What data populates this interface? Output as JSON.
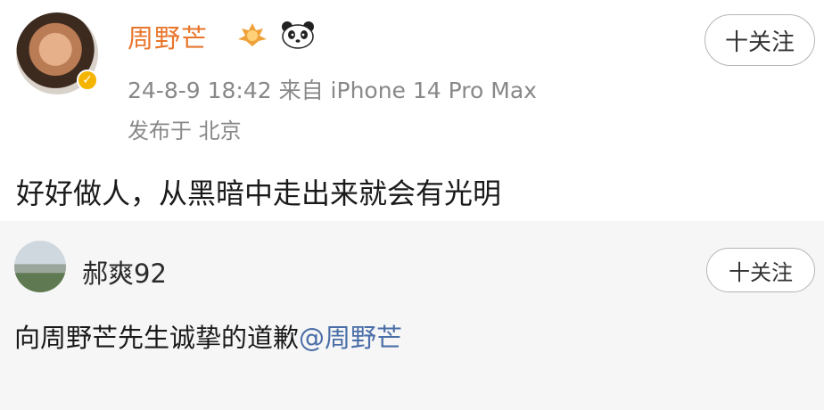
{
  "post": {
    "author": "周野芒",
    "meta": "24-8-9 18:42  来自 iPhone 14 Pro Max",
    "location": "发布于 北京",
    "follow_label": "十关注",
    "content": "好好做人，从黑暗中走出来就会有光明"
  },
  "comment": {
    "author": "郝爽92",
    "follow_label": "十关注",
    "text": "向周野芒先生诚挚的道歉",
    "mention": "@周野芒"
  },
  "colors": {
    "author_name": "#e8762c",
    "meta_text": "#888888",
    "mention": "#4a6ea8"
  },
  "icons": [
    "verified-badge-icon",
    "medal-icon",
    "panda-icon"
  ]
}
